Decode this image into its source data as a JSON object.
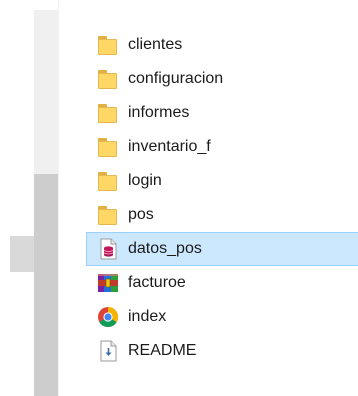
{
  "file_list": {
    "items": [
      {
        "name": "clientes",
        "icon": "folder-icon"
      },
      {
        "name": "configuracion",
        "icon": "folder-icon"
      },
      {
        "name": "informes",
        "icon": "folder-icon"
      },
      {
        "name": "inventario_f",
        "icon": "folder-icon"
      },
      {
        "name": "login",
        "icon": "folder-icon"
      },
      {
        "name": "pos",
        "icon": "folder-icon"
      },
      {
        "name": "datos_pos",
        "icon": "database-file-icon",
        "selected": true
      },
      {
        "name": "facturoe",
        "icon": "winrar-archive-icon"
      },
      {
        "name": "index",
        "icon": "chrome-html-icon"
      },
      {
        "name": "README",
        "icon": "text-file-icon"
      }
    ]
  },
  "colors": {
    "selection_bg": "#cce8ff",
    "selection_border": "#99d1ff",
    "folder_yellow": "#ffd764",
    "scrollbar_thumb": "#cdcdcd"
  }
}
